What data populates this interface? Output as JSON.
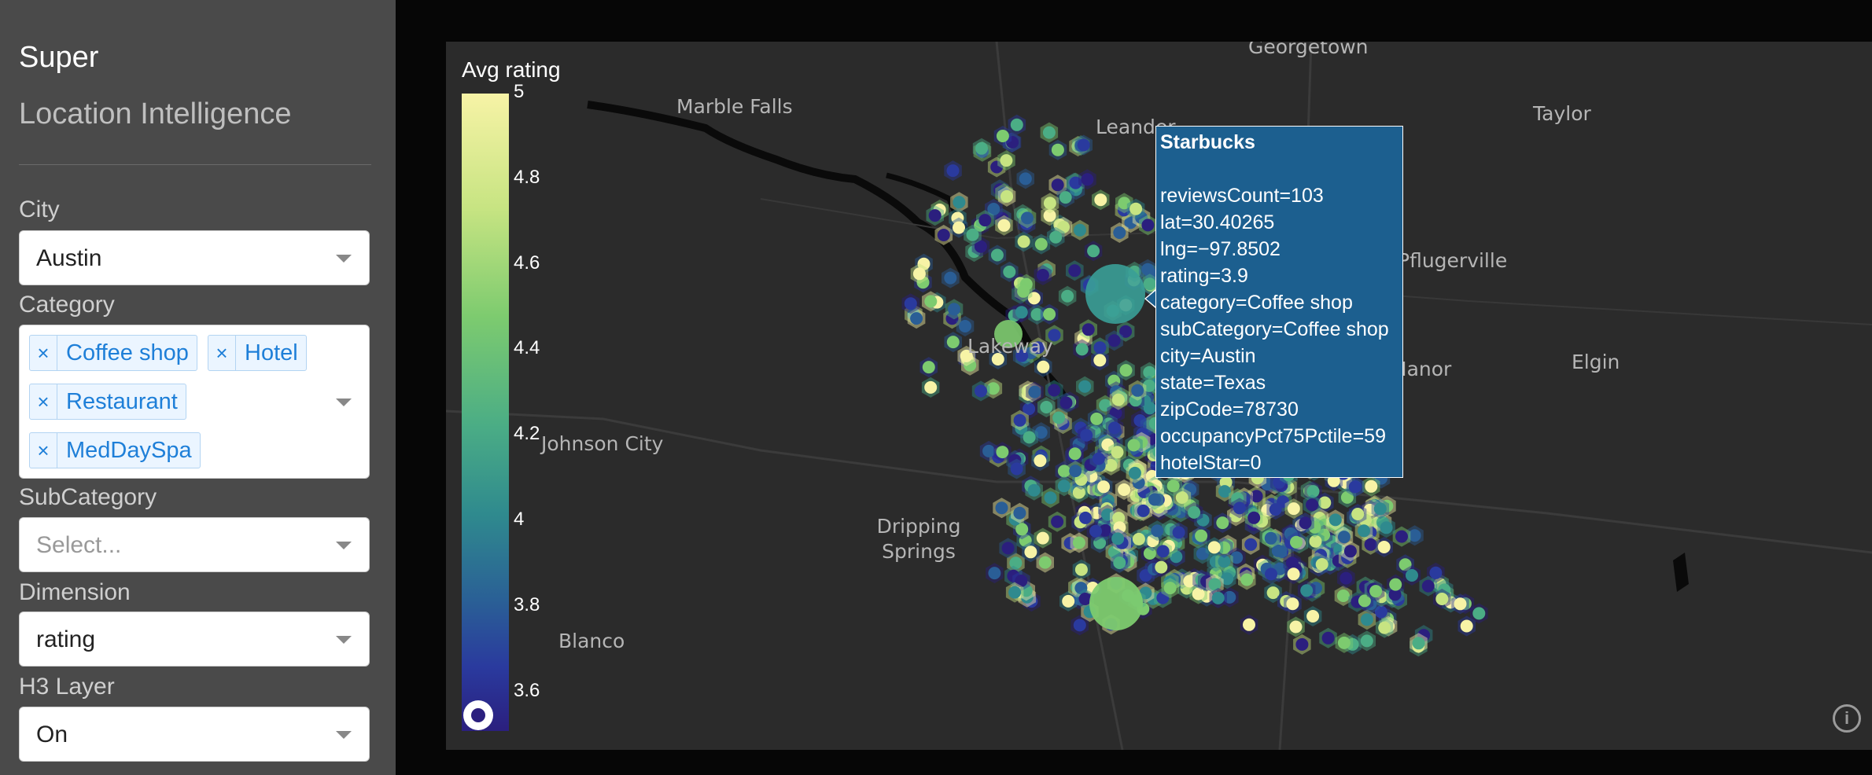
{
  "sidebar": {
    "brand_line1": "Super",
    "brand_line2": "Location Intelligence",
    "city": {
      "label": "City",
      "value": "Austin"
    },
    "category": {
      "label": "Category",
      "chips": [
        "Coffee shop",
        "Hotel",
        "Restaurant",
        "MedDaySpa"
      ],
      "remove_glyph": "×"
    },
    "subcategory": {
      "label": "SubCategory",
      "placeholder": "Select..."
    },
    "dimension": {
      "label": "Dimension",
      "value": "rating"
    },
    "h3_layer": {
      "label": "H3 Layer",
      "value": "On"
    }
  },
  "map": {
    "places": [
      "Georgetown",
      "Marble Falls",
      "Leander",
      "Taylor",
      "Lakeway",
      "Elgin",
      "Johnson City",
      "Dripping Springs",
      "Blanco",
      "Manor",
      "Pflugerville"
    ],
    "legend": {
      "title": "Avg rating",
      "ticks": [
        "5",
        "4.8",
        "4.6",
        "4.4",
        "4.2",
        "4",
        "3.8",
        "3.6"
      ],
      "range": [
        3.5,
        5
      ]
    },
    "tooltip": {
      "title": "Starbucks",
      "lines": [
        "reviewsCount=103",
        "lat=30.40265",
        "lng=−97.8502",
        "rating=3.9",
        "category=Coffee shop",
        "subCategory=Coffee shop",
        "city=Austin",
        "state=Texas",
        "zipCode=78730",
        "occupancyPct75Pctile=59",
        "hotelStar=0"
      ]
    },
    "info_glyph": "i",
    "colors": {
      "background": "#2b2b2b",
      "water": "#0a0a0a",
      "tooltip": "#1c5f8f"
    }
  }
}
